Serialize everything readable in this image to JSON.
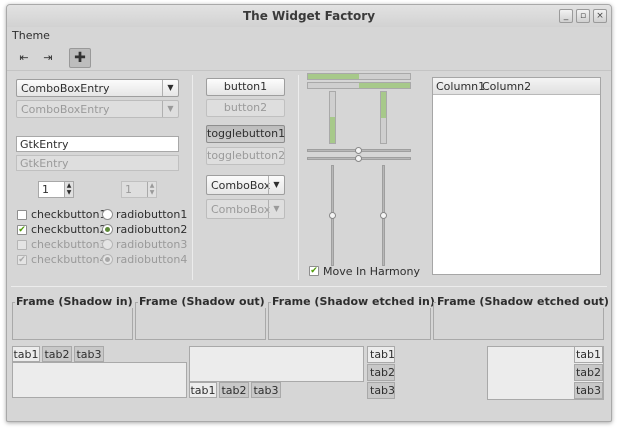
{
  "window": {
    "title": "The Widget Factory"
  },
  "titlebar_buttons": {
    "minimize": "_",
    "maximize": "▫",
    "close": "×"
  },
  "menubar": {
    "theme": "Theme"
  },
  "toolbar": {
    "icons": [
      "go-first-icon",
      "go-last-icon",
      "add-icon"
    ]
  },
  "left": {
    "combo_entry": "ComboBoxEntry",
    "combo_entry_disabled": "ComboBoxEntry",
    "entry": "GtkEntry",
    "entry_disabled": "GtkEntry",
    "spin_value": "1",
    "spin_value_disabled": "1",
    "checks": [
      {
        "label": "checkbutton1",
        "checked": false,
        "enabled": true
      },
      {
        "label": "checkbutton2",
        "checked": true,
        "enabled": true
      },
      {
        "label": "checkbutton3",
        "checked": false,
        "enabled": false
      },
      {
        "label": "checkbutton4",
        "checked": true,
        "enabled": false
      }
    ],
    "radios": [
      {
        "label": "radiobutton1",
        "selected": false,
        "enabled": true
      },
      {
        "label": "radiobutton2",
        "selected": true,
        "enabled": true
      },
      {
        "label": "radiobutton3",
        "selected": false,
        "enabled": false
      },
      {
        "label": "radiobutton4",
        "selected": true,
        "enabled": false
      }
    ]
  },
  "middle": {
    "button1": "button1",
    "button2": "button2",
    "toggle1": "togglebutton1",
    "toggle2": "togglebutton2",
    "combo": "ComboBox",
    "combo_disabled": "ComboBox"
  },
  "sliders": {
    "progress_h1": 0.5,
    "progress_h2": 0.5,
    "progress_v1": 0.5,
    "progress_v2": 0.5,
    "scale_h1": 0.5,
    "scale_h2": 0.5,
    "scale_v1": 0.5,
    "scale_v2": 0.5,
    "move_in_harmony": "Move In Harmony"
  },
  "treeview": {
    "columns": [
      "Column1",
      "Column2"
    ]
  },
  "frames": [
    "Frame (Shadow in)",
    "Frame (Shadow out)",
    "Frame (Shadow etched in)",
    "Frame (Shadow etched out)"
  ],
  "notebooks": {
    "tabs": [
      "tab1",
      "tab2",
      "tab3"
    ]
  },
  "colors": {
    "accent": "#a7c98a",
    "check": "#4e9a06",
    "background": "#d6d6d6"
  }
}
